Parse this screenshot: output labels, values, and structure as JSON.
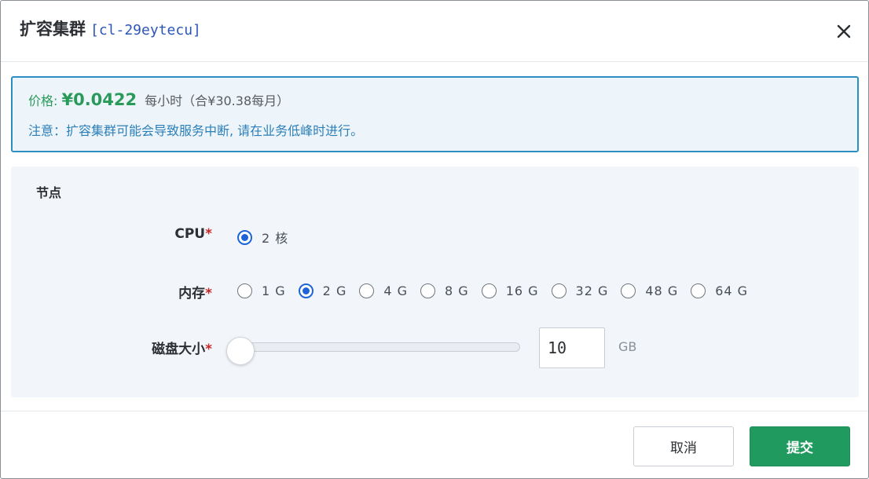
{
  "dialog": {
    "title": "扩容集群",
    "cluster_id": "[cl-29eytecu]",
    "close_icon": "close-icon"
  },
  "notice": {
    "price_label": "价格: ",
    "price_value": "¥0.0422",
    "price_note": "每小时（合¥30.38每月）",
    "warning": "注意：扩容集群可能会导致服务中断, 请在业务低峰时进行。"
  },
  "node": {
    "section_title": "节点",
    "cpu": {
      "label": "CPU",
      "required": "*",
      "options": [
        {
          "label": "2 核",
          "checked": true
        }
      ]
    },
    "memory": {
      "label": "内存",
      "required": "*",
      "options": [
        {
          "label": "1 G",
          "checked": false
        },
        {
          "label": "2 G",
          "checked": true
        },
        {
          "label": "4 G",
          "checked": false
        },
        {
          "label": "8 G",
          "checked": false
        },
        {
          "label": "16 G",
          "checked": false
        },
        {
          "label": "32 G",
          "checked": false
        },
        {
          "label": "48 G",
          "checked": false
        },
        {
          "label": "64 G",
          "checked": false
        }
      ]
    },
    "disk": {
      "label": "磁盘大小",
      "required": "*",
      "value": "10",
      "unit": "GB",
      "slider_fraction": 0.0
    }
  },
  "footer": {
    "cancel_label": "取消",
    "submit_label": "提交"
  },
  "colors": {
    "accent_blue": "#1e64d8",
    "price_green": "#2a9a5a",
    "notice_border": "#2c8fc2",
    "submit_green": "#209a5f"
  }
}
